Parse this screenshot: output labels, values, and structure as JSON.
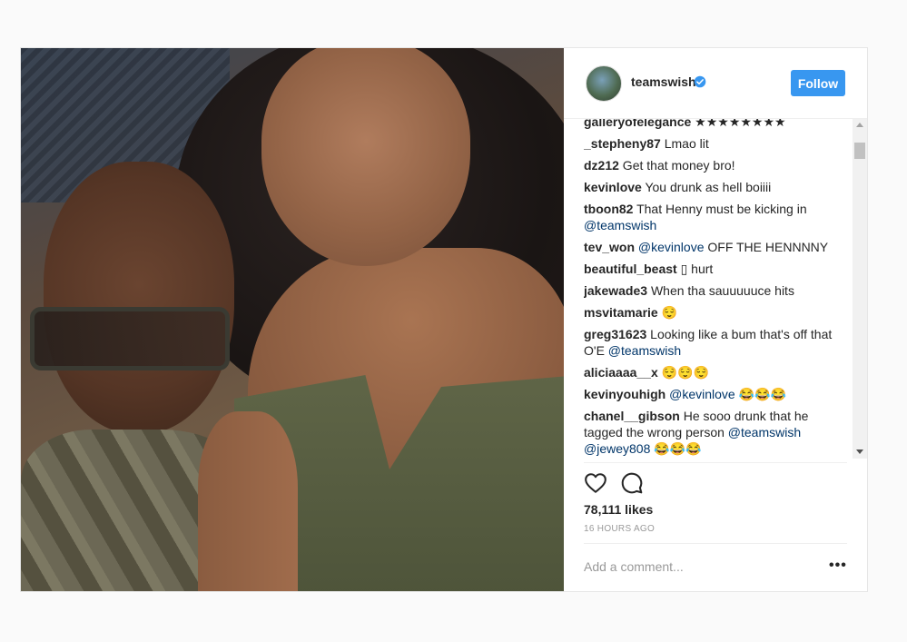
{
  "post": {
    "username": "teamswish",
    "follow_label": "Follow",
    "likes": "78,111 likes",
    "timestamp": "16 HOURS AGO",
    "add_comment_placeholder": "Add a comment...",
    "more_label": "•••"
  },
  "comments": [
    {
      "user": "galleryofelegance",
      "pre": " ",
      "mention": "",
      "post": "★★★★★★★★"
    },
    {
      "user": "_stepheny87",
      "pre": " Lmao lit",
      "mention": "",
      "post": ""
    },
    {
      "user": "dz212",
      "pre": " Get that money bro!",
      "mention": "",
      "post": ""
    },
    {
      "user": "kevinlove",
      "pre": " You drunk as hell boiiii",
      "mention": "",
      "post": ""
    },
    {
      "user": "tboon82",
      "pre": " That Henny must be kicking in ",
      "mention": "@teamswish",
      "post": ""
    },
    {
      "user": "tev_won",
      "pre": " ",
      "mention": "@kevinlove",
      "post": " OFF THE HENNNNY"
    },
    {
      "user": "beautiful_beast",
      "pre": " ▯ hurt",
      "mention": "",
      "post": ""
    },
    {
      "user": "jakewade3",
      "pre": " When tha sauuuuuce hits",
      "mention": "",
      "post": ""
    },
    {
      "user": "msvitamarie",
      "pre": " 😌",
      "mention": "",
      "post": ""
    },
    {
      "user": "greg31623",
      "pre": " Looking like a bum that's off that O'E ",
      "mention": "@teamswish",
      "post": ""
    },
    {
      "user": "aliciaaaa__x",
      "pre": " 😌😌😌",
      "mention": "",
      "post": ""
    },
    {
      "user": "kevinyouhigh",
      "pre": " ",
      "mention": "@kevinlove",
      "post": " 😂😂😂"
    },
    {
      "user": "chanel__gibson",
      "pre": " He sooo drunk that he tagged the wrong person ",
      "mention": "@teamswish @jewey808",
      "post": " 😂😂😂"
    }
  ],
  "colors": {
    "accent": "#3897f0",
    "mention": "#003569",
    "muted": "#999999"
  },
  "icons": {
    "verified": "verified-badge-icon",
    "like": "heart-icon",
    "comment": "comment-bubble-icon"
  }
}
